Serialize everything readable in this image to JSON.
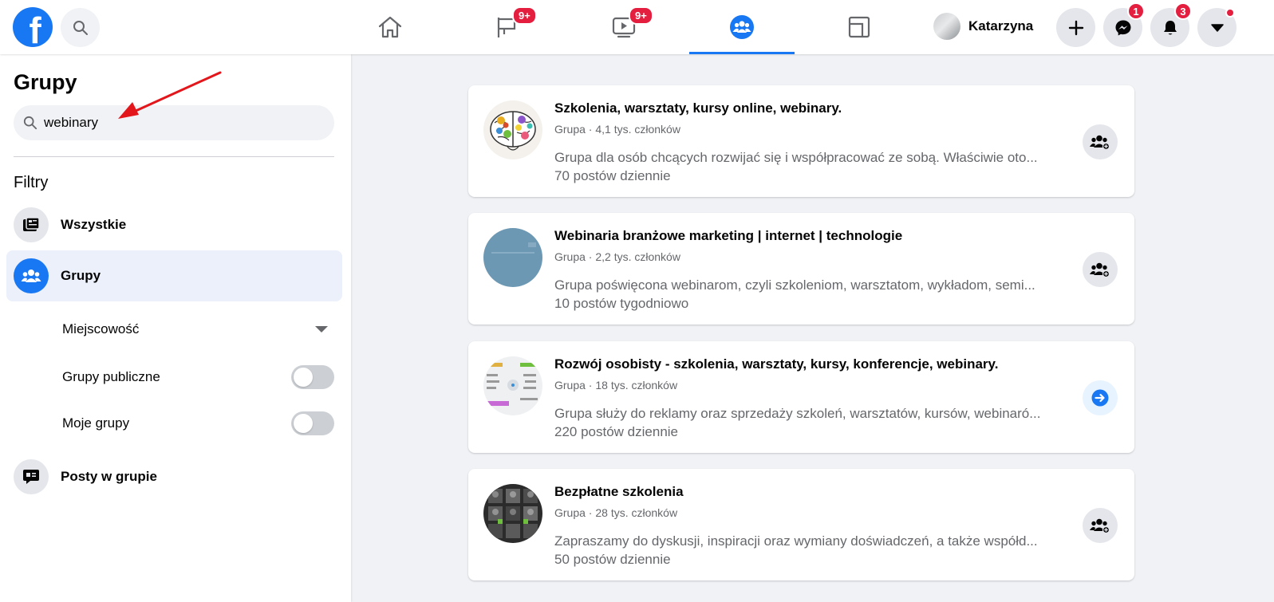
{
  "topbar": {
    "logo_letter": "f",
    "nav": [
      {
        "name": "home",
        "badge": ""
      },
      {
        "name": "pages",
        "badge": "9+"
      },
      {
        "name": "watch",
        "badge": "9+"
      },
      {
        "name": "groups",
        "badge": ""
      },
      {
        "name": "gaming",
        "badge": ""
      }
    ],
    "profile_name": "Katarzyna",
    "messenger_badge": "1",
    "notifications_badge": "3"
  },
  "sidebar": {
    "title": "Grupy",
    "search_value": "webinary",
    "filters_label": "Filtry",
    "items": [
      {
        "label": "Wszystkie"
      },
      {
        "label": "Grupy"
      },
      {
        "label": "Posty w grupie"
      }
    ],
    "sub_filters": {
      "location": "Miejscowość",
      "public_groups": "Grupy publiczne",
      "my_groups": "Moje grupy"
    },
    "toggles": {
      "public_groups": false,
      "my_groups": false
    }
  },
  "results": [
    {
      "title": "Szkolenia, warsztaty, kursy online, webinary.",
      "meta": "Grupa · 4,1 tys. członków",
      "description": "Grupa dla osób chcących rozwijać się i współpracować ze sobą. Właściwie oto...",
      "frequency": "70 postów dziennie",
      "action": "join"
    },
    {
      "title": "Webinaria branżowe marketing | internet | technologie",
      "meta": "Grupa · 2,2 tys. członków",
      "description": "Grupa poświęcona webinarom, czyli szkoleniom, warsztatom, wykładom, semi...",
      "frequency": "10 postów tygodniowo",
      "action": "join"
    },
    {
      "title": "Rozwój osobisty - szkolenia, warsztaty, kursy, konferencje, webinary.",
      "meta": "Grupa · 18 tys. członków",
      "description": "Grupa służy do reklamy oraz sprzedaży szkoleń, warsztatów, kursów, webinaró...",
      "frequency": "220 postów dziennie",
      "action": "visit"
    },
    {
      "title": "Bezpłatne szkolenia",
      "meta": "Grupa · 28 tys. członków",
      "description": "Zapraszamy do dyskusji, inspiracji oraz wymiany doświadczeń, a także współd...",
      "frequency": "50 postów dziennie",
      "action": "join"
    }
  ],
  "colors": {
    "brand": "#1877f2",
    "badge": "#e41e3f",
    "annotation": "#e3161b"
  }
}
